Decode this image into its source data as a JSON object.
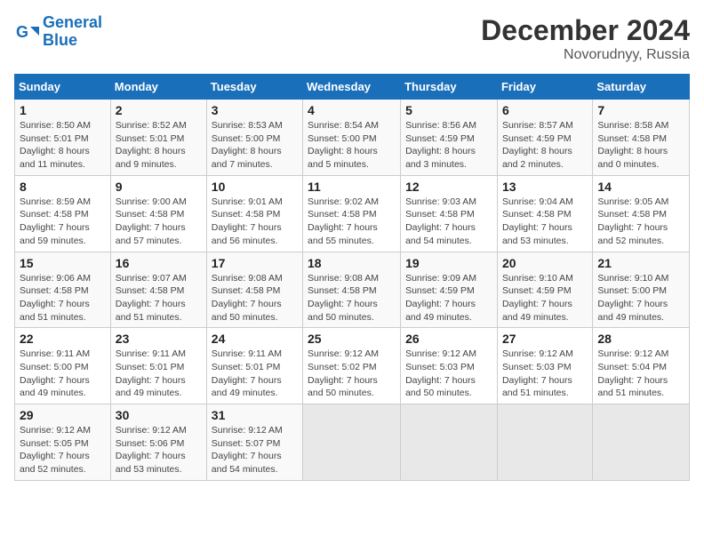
{
  "logo": {
    "line1": "General",
    "line2": "Blue"
  },
  "title": "December 2024",
  "subtitle": "Novorudnyy, Russia",
  "days_header": [
    "Sunday",
    "Monday",
    "Tuesday",
    "Wednesday",
    "Thursday",
    "Friday",
    "Saturday"
  ],
  "weeks": [
    [
      {
        "num": "1",
        "sunrise": "8:50 AM",
        "sunset": "5:01 PM",
        "daylight": "8 hours and 11 minutes."
      },
      {
        "num": "2",
        "sunrise": "8:52 AM",
        "sunset": "5:01 PM",
        "daylight": "8 hours and 9 minutes."
      },
      {
        "num": "3",
        "sunrise": "8:53 AM",
        "sunset": "5:00 PM",
        "daylight": "8 hours and 7 minutes."
      },
      {
        "num": "4",
        "sunrise": "8:54 AM",
        "sunset": "5:00 PM",
        "daylight": "8 hours and 5 minutes."
      },
      {
        "num": "5",
        "sunrise": "8:56 AM",
        "sunset": "4:59 PM",
        "daylight": "8 hours and 3 minutes."
      },
      {
        "num": "6",
        "sunrise": "8:57 AM",
        "sunset": "4:59 PM",
        "daylight": "8 hours and 2 minutes."
      },
      {
        "num": "7",
        "sunrise": "8:58 AM",
        "sunset": "4:58 PM",
        "daylight": "8 hours and 0 minutes."
      }
    ],
    [
      {
        "num": "8",
        "sunrise": "8:59 AM",
        "sunset": "4:58 PM",
        "daylight": "7 hours and 59 minutes."
      },
      {
        "num": "9",
        "sunrise": "9:00 AM",
        "sunset": "4:58 PM",
        "daylight": "7 hours and 57 minutes."
      },
      {
        "num": "10",
        "sunrise": "9:01 AM",
        "sunset": "4:58 PM",
        "daylight": "7 hours and 56 minutes."
      },
      {
        "num": "11",
        "sunrise": "9:02 AM",
        "sunset": "4:58 PM",
        "daylight": "7 hours and 55 minutes."
      },
      {
        "num": "12",
        "sunrise": "9:03 AM",
        "sunset": "4:58 PM",
        "daylight": "7 hours and 54 minutes."
      },
      {
        "num": "13",
        "sunrise": "9:04 AM",
        "sunset": "4:58 PM",
        "daylight": "7 hours and 53 minutes."
      },
      {
        "num": "14",
        "sunrise": "9:05 AM",
        "sunset": "4:58 PM",
        "daylight": "7 hours and 52 minutes."
      }
    ],
    [
      {
        "num": "15",
        "sunrise": "9:06 AM",
        "sunset": "4:58 PM",
        "daylight": "7 hours and 51 minutes."
      },
      {
        "num": "16",
        "sunrise": "9:07 AM",
        "sunset": "4:58 PM",
        "daylight": "7 hours and 51 minutes."
      },
      {
        "num": "17",
        "sunrise": "9:08 AM",
        "sunset": "4:58 PM",
        "daylight": "7 hours and 50 minutes."
      },
      {
        "num": "18",
        "sunrise": "9:08 AM",
        "sunset": "4:58 PM",
        "daylight": "7 hours and 50 minutes."
      },
      {
        "num": "19",
        "sunrise": "9:09 AM",
        "sunset": "4:59 PM",
        "daylight": "7 hours and 49 minutes."
      },
      {
        "num": "20",
        "sunrise": "9:10 AM",
        "sunset": "4:59 PM",
        "daylight": "7 hours and 49 minutes."
      },
      {
        "num": "21",
        "sunrise": "9:10 AM",
        "sunset": "5:00 PM",
        "daylight": "7 hours and 49 minutes."
      }
    ],
    [
      {
        "num": "22",
        "sunrise": "9:11 AM",
        "sunset": "5:00 PM",
        "daylight": "7 hours and 49 minutes."
      },
      {
        "num": "23",
        "sunrise": "9:11 AM",
        "sunset": "5:01 PM",
        "daylight": "7 hours and 49 minutes."
      },
      {
        "num": "24",
        "sunrise": "9:11 AM",
        "sunset": "5:01 PM",
        "daylight": "7 hours and 49 minutes."
      },
      {
        "num": "25",
        "sunrise": "9:12 AM",
        "sunset": "5:02 PM",
        "daylight": "7 hours and 50 minutes."
      },
      {
        "num": "26",
        "sunrise": "9:12 AM",
        "sunset": "5:03 PM",
        "daylight": "7 hours and 50 minutes."
      },
      {
        "num": "27",
        "sunrise": "9:12 AM",
        "sunset": "5:03 PM",
        "daylight": "7 hours and 51 minutes."
      },
      {
        "num": "28",
        "sunrise": "9:12 AM",
        "sunset": "5:04 PM",
        "daylight": "7 hours and 51 minutes."
      }
    ],
    [
      {
        "num": "29",
        "sunrise": "9:12 AM",
        "sunset": "5:05 PM",
        "daylight": "7 hours and 52 minutes."
      },
      {
        "num": "30",
        "sunrise": "9:12 AM",
        "sunset": "5:06 PM",
        "daylight": "7 hours and 53 minutes."
      },
      {
        "num": "31",
        "sunrise": "9:12 AM",
        "sunset": "5:07 PM",
        "daylight": "7 hours and 54 minutes."
      },
      null,
      null,
      null,
      null
    ]
  ]
}
